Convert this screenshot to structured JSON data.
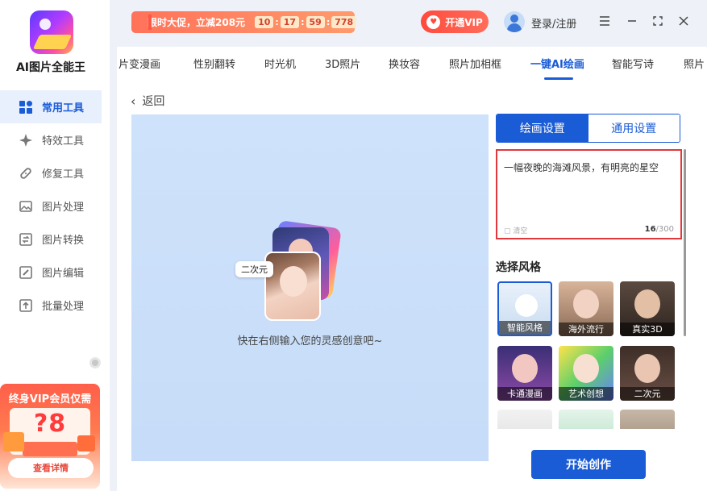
{
  "app": {
    "name": "AI图片全能王"
  },
  "sidebar": {
    "items": [
      {
        "label": "常用工具",
        "icon": "grid-icon",
        "active": true
      },
      {
        "label": "特效工具",
        "icon": "sparkle-icon",
        "active": false
      },
      {
        "label": "修复工具",
        "icon": "bandage-icon",
        "active": false
      },
      {
        "label": "图片处理",
        "icon": "image-icon",
        "active": false
      },
      {
        "label": "图片转换",
        "icon": "convert-icon",
        "active": false
      },
      {
        "label": "图片编辑",
        "icon": "edit-icon",
        "active": false
      },
      {
        "label": "批量处理",
        "icon": "upload-icon",
        "active": false
      }
    ],
    "vip_promo": {
      "title": "终身VIP会员仅需",
      "price": "?8",
      "button": "查看详情"
    }
  },
  "topbar": {
    "promo_text": "限时大促，立减208元",
    "timer": [
      "10",
      "17",
      "59",
      "778"
    ],
    "vip_button": "开通VIP",
    "login": "登录/注册"
  },
  "tabs": [
    {
      "label": "片变漫画"
    },
    {
      "label": "性别翻转"
    },
    {
      "label": "时光机"
    },
    {
      "label": "3D照片"
    },
    {
      "label": "换妆容"
    },
    {
      "label": "照片加相框"
    },
    {
      "label": "一键AI绘画",
      "active": true
    },
    {
      "label": "智能写诗"
    },
    {
      "label": "照片"
    }
  ],
  "main": {
    "back": "返回",
    "canvas_tag": "二次元",
    "canvas_hint": "快在右侧输入您的灵感创意吧~"
  },
  "settings": {
    "tabs": [
      "绘画设置",
      "通用设置"
    ],
    "prompt": "一幅夜晚的海滩风景，有明亮的星空",
    "clear": "清空",
    "count": "16",
    "max": "/300",
    "style_title": "选择风格",
    "styles": [
      {
        "label": "智能风格",
        "selected": true
      },
      {
        "label": "海外流行"
      },
      {
        "label": "真实3D"
      },
      {
        "label": "卡通漫画"
      },
      {
        "label": "艺术创想"
      },
      {
        "label": "二次元"
      }
    ],
    "start_button": "开始创作"
  },
  "colors": {
    "primary": "#1a5bd6",
    "accent_red": "#ff4b3e",
    "canvas_bg": "#cfe2fb"
  }
}
